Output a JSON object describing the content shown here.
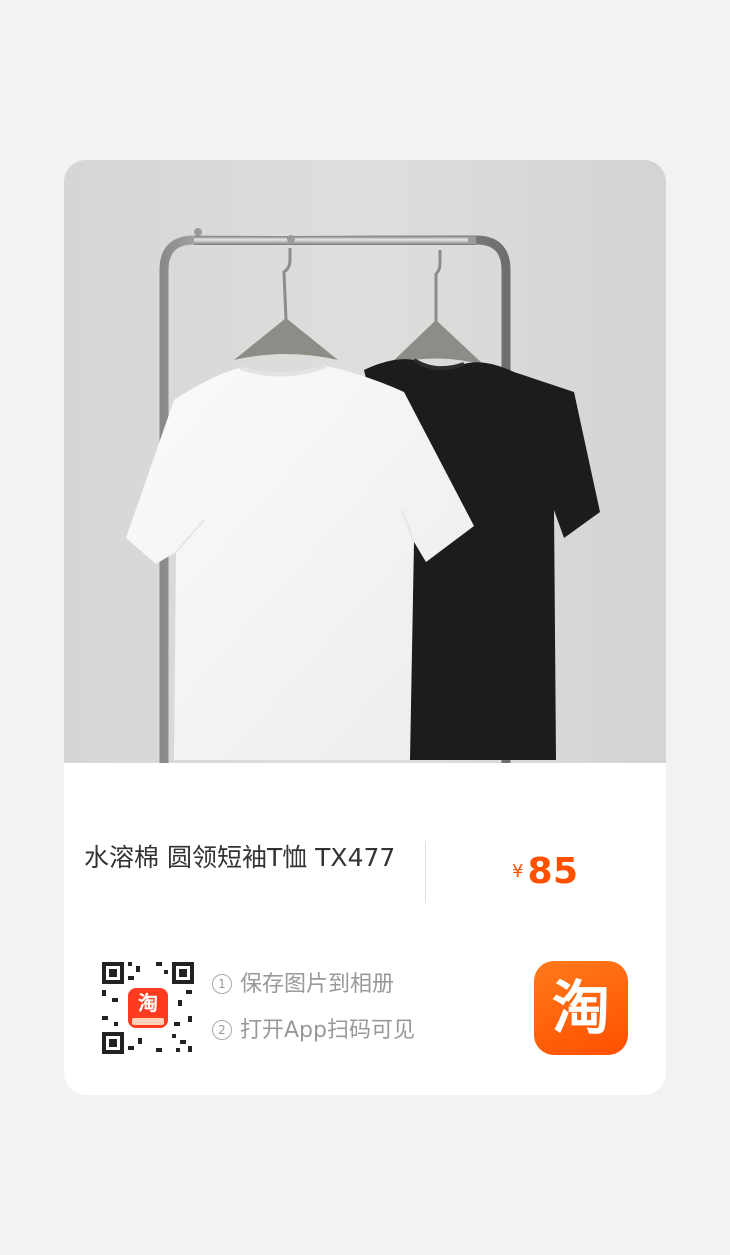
{
  "product": {
    "title": "水溶棉 圆领短袖T恤 TX477",
    "currency": "¥",
    "price": "85",
    "image": "two-tshirts-on-rack-photo"
  },
  "share": {
    "qr_icon": "qr-code-icon",
    "qr_badge": "淘",
    "steps": [
      {
        "num": "1",
        "text": "保存图片到相册"
      },
      {
        "num": "2",
        "text": "打开App扫码可见"
      }
    ],
    "app_logo": "淘"
  },
  "colors": {
    "accent": "#ff5000",
    "title_text": "#333333",
    "hint_text": "#999999",
    "background": "#f2f2f2"
  }
}
